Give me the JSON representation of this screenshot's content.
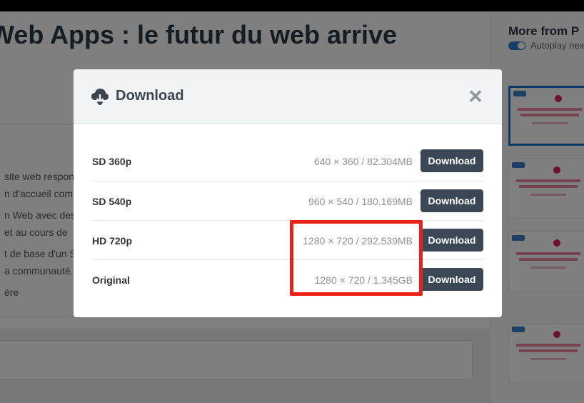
{
  "page": {
    "title": "Web Apps : le futur du web arrive",
    "description_lines": [
      "site web respon",
      "n d'accueil com",
      "n Web avec des",
      " et au cours de",
      "t de base d'un S",
      "a communauté.",
      "ère"
    ]
  },
  "sidebar": {
    "title": "More from P",
    "autoplay_label": "Autoplay nex",
    "autoplay_on": true,
    "accent_color": "#1d73c9"
  },
  "modal": {
    "title": "Download",
    "icon": "cloud-download-icon",
    "close_icon": "close-icon",
    "rows": [
      {
        "quality": "SD 360p",
        "meta": "640 × 360 / 82.304MB",
        "button": "Download"
      },
      {
        "quality": "SD 540p",
        "meta": "960 × 540 / 180.169MB",
        "button": "Download"
      },
      {
        "quality": "HD 720p",
        "meta": "1280 × 720 / 292.539MB",
        "button": "Download"
      },
      {
        "quality": "Original",
        "meta": "1280 × 720 / 1.345GB",
        "button": "Download"
      }
    ],
    "button_color": "#3a4855",
    "highlight_color": "#e8211a"
  }
}
